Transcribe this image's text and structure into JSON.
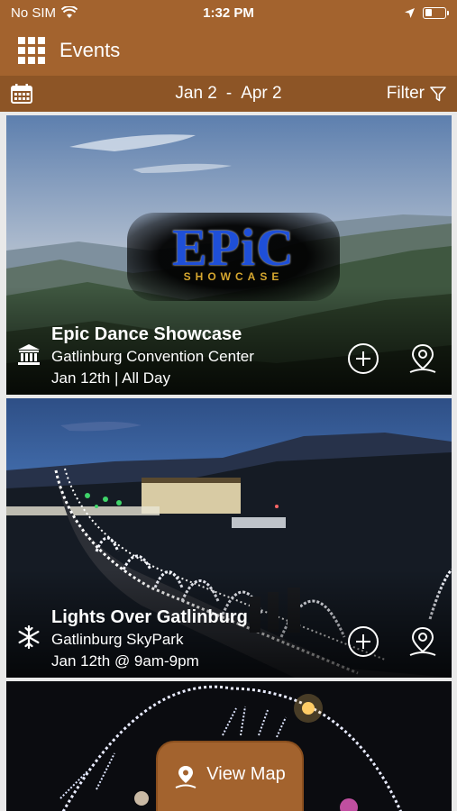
{
  "status": {
    "carrier": "No SIM",
    "time": "1:32 PM"
  },
  "header": {
    "title": "Events"
  },
  "datebar": {
    "start": "Jan 2",
    "separator": "-",
    "end": "Apr 2",
    "filter_label": "Filter"
  },
  "events": [
    {
      "title": "Epic Dance Showcase",
      "venue": "Gatlinburg Convention Center",
      "when": "Jan 12th | All Day",
      "category_icon": "building-icon"
    },
    {
      "title": "Lights Over Gatlinburg",
      "venue": "Gatlinburg SkyPark",
      "when": "Jan 12th @ 9am-9pm",
      "category_icon": "snowflake-icon"
    }
  ],
  "logo": {
    "word": "EPiC",
    "sub": "SHOWCASE"
  },
  "view_map_label": "View Map",
  "colors": {
    "header": "#a3632e",
    "date_bar": "#8d5526"
  }
}
